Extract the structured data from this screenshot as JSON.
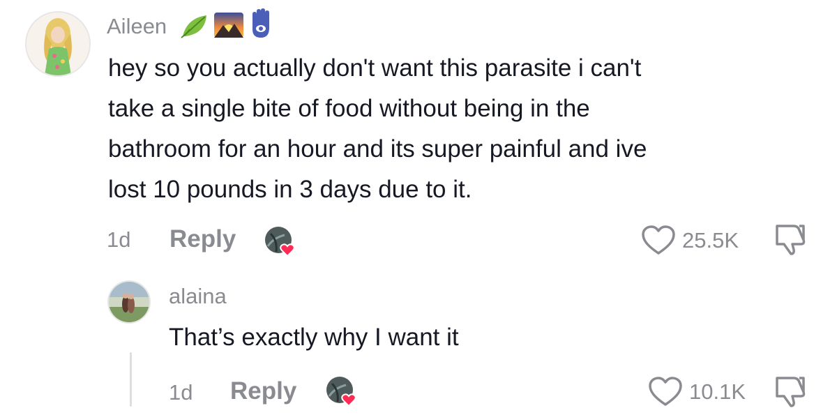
{
  "comment": {
    "username": "Aileen",
    "username_emoji": [
      "leaf-icon",
      "sunrise-icon",
      "hamsa-icon"
    ],
    "text_lines": [
      "hey so you actually don't want this parasite i can't",
      "take a single bite of food without being in the",
      "bathroom for an hour and its super painful and ive",
      "lost 10 pounds in 3 days due to it."
    ],
    "age": "1d",
    "reply_label": "Reply",
    "like_count": "25.5K"
  },
  "reply": {
    "username": "alaina",
    "text": "That’s exactly why I want it",
    "age": "1d",
    "reply_label": "Reply",
    "like_count": "10.1K"
  },
  "colors": {
    "text": "#161823",
    "muted": "#8a8b91",
    "heart_badge": "#fe2c55"
  }
}
